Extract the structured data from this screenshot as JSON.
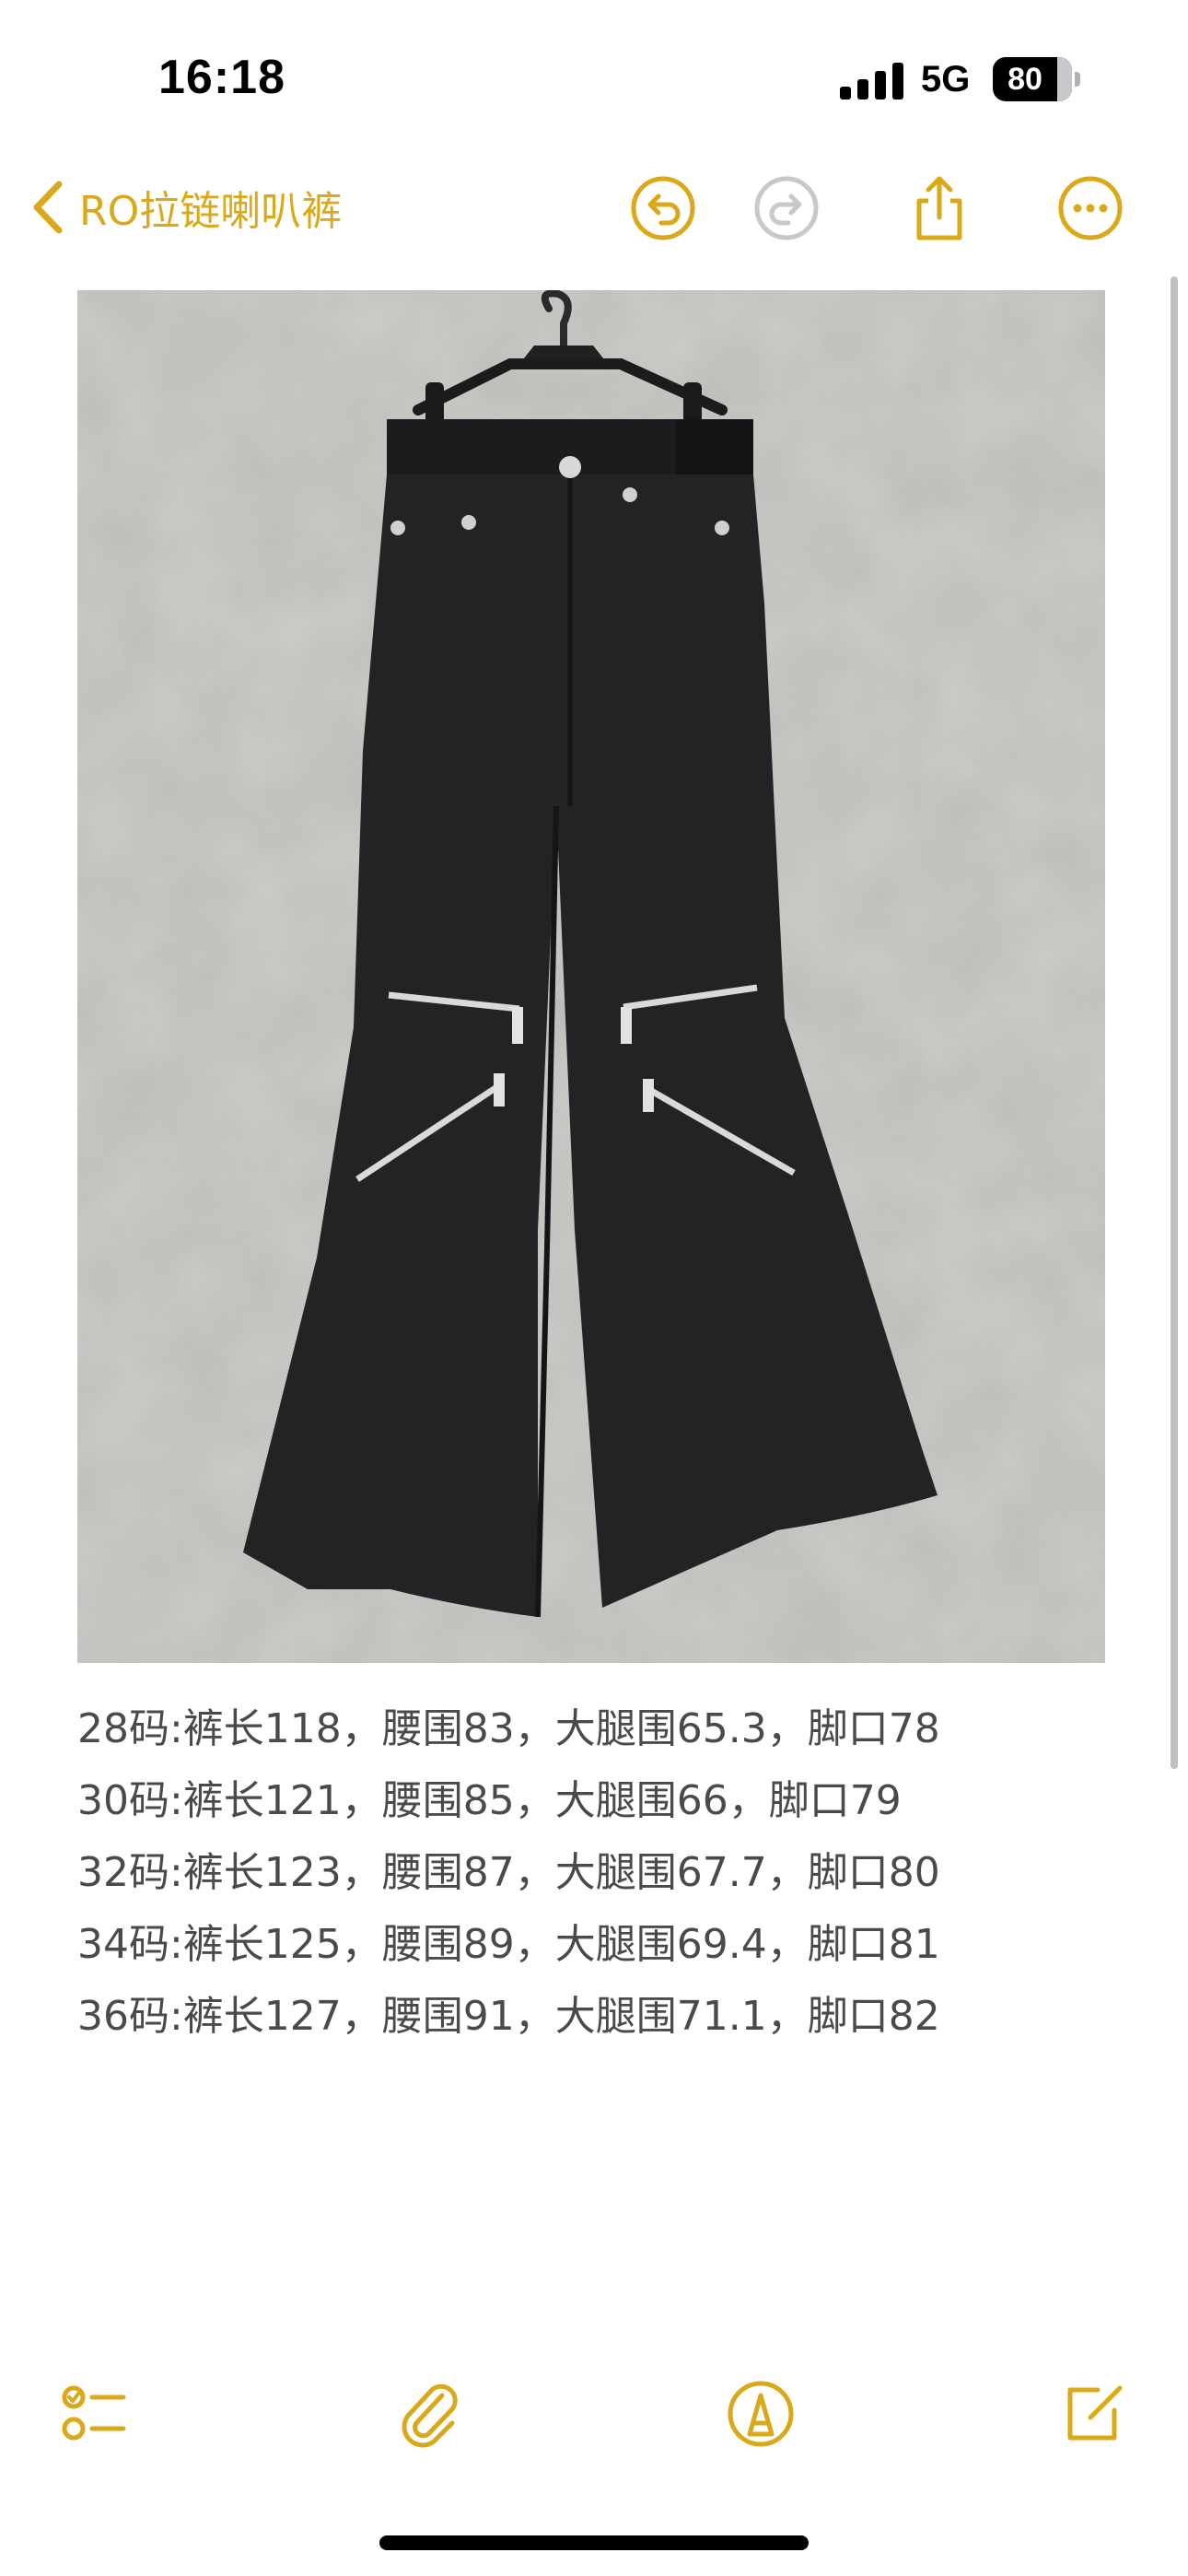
{
  "status_bar": {
    "time": "16:18",
    "network": "5G",
    "battery_level": "80",
    "battery_fraction": 0.8
  },
  "nav": {
    "title": "RO拉链喇叭裤",
    "icons": [
      "chevron-left-icon",
      "undo-icon",
      "redo-icon",
      "share-icon",
      "more-icon"
    ],
    "accent_color": "#d9a91a",
    "disabled_color": "#c7c7cc"
  },
  "note": {
    "photo": {
      "subject": "flared-zip-trousers"
    },
    "size_lines": [
      "28码:裤长118，腰围83，大腿围65.3，脚口78",
      "30码:裤长121，腰围85，大腿围66，脚口79",
      "32码:裤长123，腰围87，大腿围67.7，脚口80",
      "34码:裤长125，腰围89，大腿围69.4，脚口81",
      "36码:裤长127，腰围91，大腿围71.1，脚口82"
    ]
  },
  "toolbar": {
    "icons": [
      "checklist-icon",
      "attachment-icon",
      "markup-icon",
      "compose-icon"
    ]
  }
}
